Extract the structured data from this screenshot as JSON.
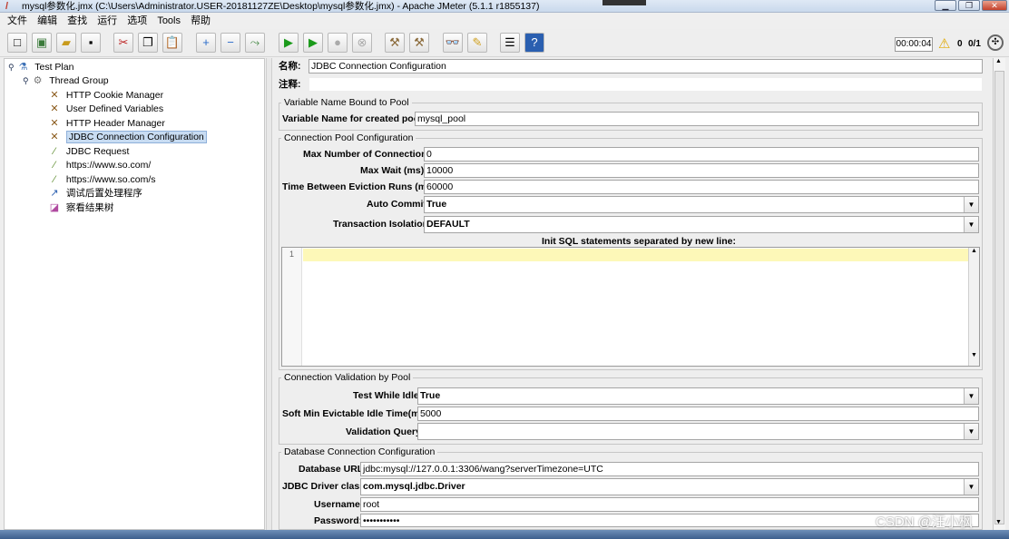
{
  "window": {
    "title": "mysql参数化.jmx (C:\\Users\\Administrator.USER-20181127ZE\\Desktop\\mysql参数化.jmx) - Apache JMeter (5.1.1 r1855137)"
  },
  "menu": [
    "文件",
    "编辑",
    "查找",
    "运行",
    "选项",
    "Tools",
    "帮助"
  ],
  "toolbar": {
    "timer": "00:00:04",
    "warnings": "0",
    "threads": "0/1"
  },
  "tree": {
    "items": [
      {
        "label": "Test Plan",
        "icon": "test-plan-icon"
      },
      {
        "label": "Thread Group",
        "icon": "thread-group-icon"
      },
      {
        "label": "HTTP Cookie Manager",
        "icon": "config-icon"
      },
      {
        "label": "User Defined Variables",
        "icon": "config-icon"
      },
      {
        "label": "HTTP Header Manager",
        "icon": "config-icon"
      },
      {
        "label": "JDBC Connection Configuration",
        "icon": "config-icon"
      },
      {
        "label": "JDBC Request",
        "icon": "sampler-icon"
      },
      {
        "label": "https://www.so.com/",
        "icon": "sampler-icon"
      },
      {
        "label": "https://www.so.com/s",
        "icon": "sampler-icon"
      },
      {
        "label": "调试后置处理程序",
        "icon": "post-processor-icon"
      },
      {
        "label": "察看结果树",
        "icon": "listener-icon"
      }
    ],
    "selected": "JDBC Connection Configuration"
  },
  "form": {
    "name_label": "名称:",
    "name_value": "JDBC Connection Configuration",
    "comment_label": "注释:",
    "comment_value": "",
    "var_section": "Variable Name Bound to Pool",
    "var_label": "Variable Name for created pool:",
    "var_value": "mysql_pool",
    "pool_section": "Connection Pool Configuration",
    "max_conn_label": "Max Number of Connections:",
    "max_conn_value": "0",
    "max_wait_label": "Max Wait (ms):",
    "max_wait_value": "10000",
    "eviction_label": "Time Between Eviction Runs (ms):",
    "eviction_value": "60000",
    "auto_commit_label": "Auto Commit:",
    "auto_commit_value": "True",
    "isolation_label": "Transaction Isolation:",
    "isolation_value": "DEFAULT",
    "init_sql_label": "Init SQL statements separated by new line:",
    "line_number": "1",
    "validation_section": "Connection Validation by Pool",
    "test_idle_label": "Test While Idle:",
    "test_idle_value": "True",
    "soft_min_label": "Soft Min Evictable Idle Time(ms):",
    "soft_min_value": "5000",
    "validation_query_label": "Validation Query:",
    "validation_query_value": "",
    "db_section": "Database Connection Configuration",
    "db_url_label": "Database URL:",
    "db_url_value": "jdbc:mysql://127.0.0.1:3306/wang?serverTimezone=UTC",
    "driver_label": "JDBC Driver class:",
    "driver_value": "com.mysql.jdbc.Driver",
    "username_label": "Username:",
    "username_value": "root",
    "password_label": "Password:",
    "password_value": "•••••••••••"
  },
  "watermark": "CSDN @汪小枫"
}
